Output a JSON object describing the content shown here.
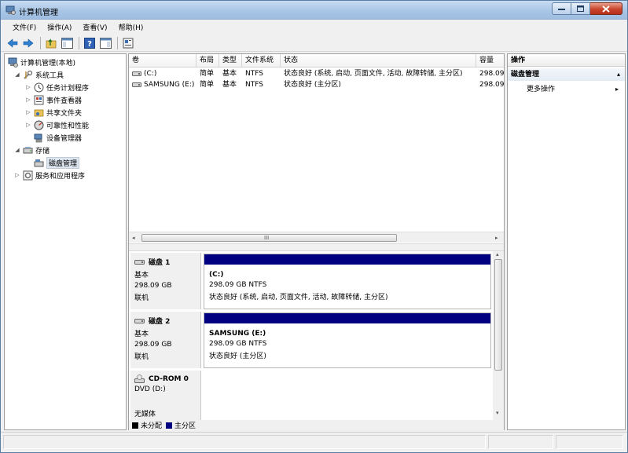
{
  "window": {
    "title": "计算机管理"
  },
  "menu": [
    {
      "label": "文件(F)"
    },
    {
      "label": "操作(A)"
    },
    {
      "label": "查看(V)"
    },
    {
      "label": "帮助(H)"
    }
  ],
  "toolbar": {
    "icons": [
      "back-arrow-icon",
      "forward-arrow-icon",
      "up-folder-icon",
      "show-hide-tree-icon",
      "help-icon",
      "show-hide-action-pane-icon",
      "properties-icon"
    ]
  },
  "tree": {
    "root": "计算机管理(本地)",
    "system_tools": "系统工具",
    "task_scheduler": "任务计划程序",
    "event_viewer": "事件查看器",
    "shared_folders": "共享文件夹",
    "reliability": "可靠性和性能",
    "device_manager": "设备管理器",
    "storage": "存储",
    "disk_management": "磁盘管理",
    "services_apps": "服务和应用程序"
  },
  "volume_list": {
    "columns": [
      "卷",
      "布局",
      "类型",
      "文件系统",
      "状态",
      "容量"
    ],
    "rows": [
      {
        "volume": "(C:)",
        "layout": "简单",
        "type": "基本",
        "fs": "NTFS",
        "status": "状态良好 (系统, 启动, 页面文件, 活动, 故障转储, 主分区)",
        "capacity": "298.09"
      },
      {
        "volume": "SAMSUNG (E:)",
        "layout": "简单",
        "type": "基本",
        "fs": "NTFS",
        "status": "状态良好 (主分区)",
        "capacity": "298.09"
      }
    ],
    "scroll_grip": "III"
  },
  "disks": [
    {
      "name": "磁盘 1",
      "kind": "基本",
      "size": "298.09 GB",
      "state": "联机",
      "volume": {
        "name": "(C:)",
        "size_fs": "298.09 GB NTFS",
        "status": "状态良好 (系统, 启动, 页面文件, 活动, 故障转储, 主分区)"
      }
    },
    {
      "name": "磁盘 2",
      "kind": "基本",
      "size": "298.09 GB",
      "state": "联机",
      "volume": {
        "name": "SAMSUNG  (E:)",
        "size_fs": "298.09 GB NTFS",
        "status": "状态良好 (主分区)"
      }
    },
    {
      "name": "CD-ROM 0",
      "kind": "DVD (D:)",
      "state": "无媒体"
    }
  ],
  "legend": {
    "unallocated": "未分配",
    "primary": "主分区",
    "colors": {
      "unallocated": "#000000",
      "primary": "#000080"
    }
  },
  "actions": {
    "header": "操作",
    "section": "磁盘管理",
    "more": "更多操作"
  }
}
